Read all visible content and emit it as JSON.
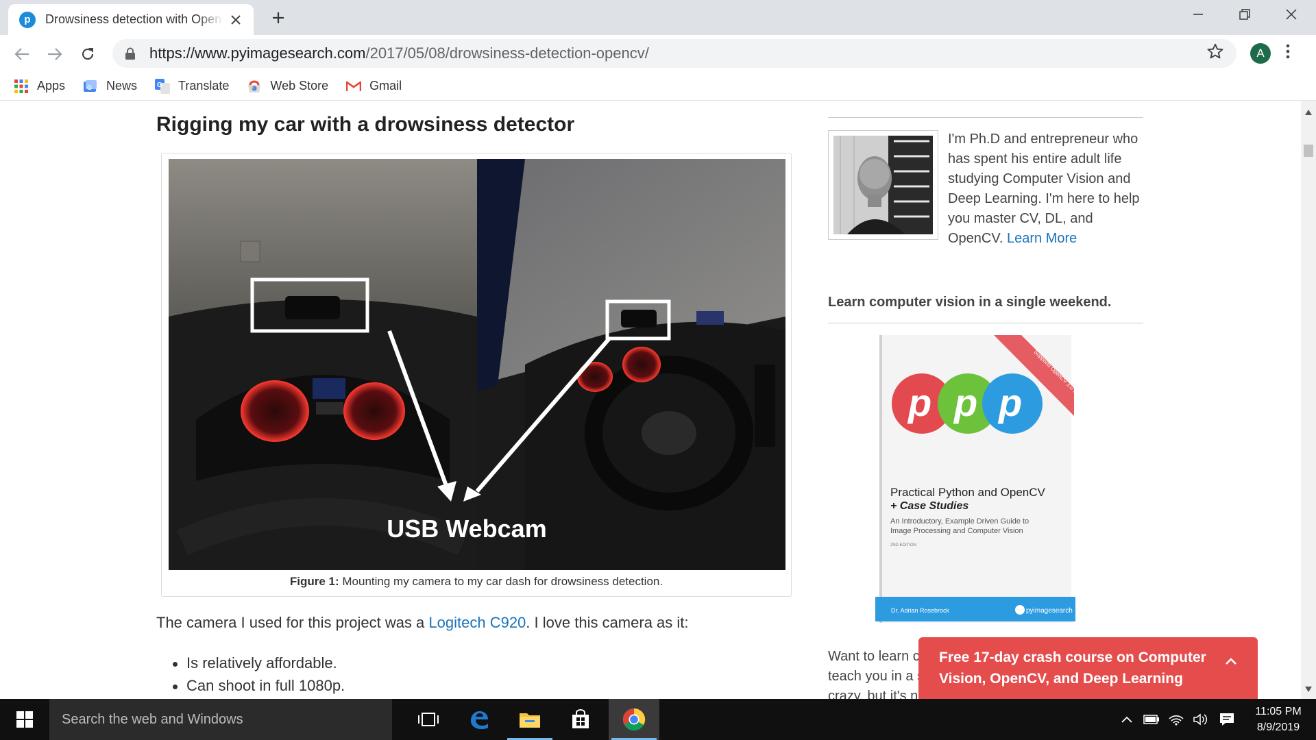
{
  "browser": {
    "tab": {
      "title": "Drowsiness detection with OpenCV",
      "favicon_text": "p"
    },
    "url_host": "https://www.pyimagesearch.com",
    "url_path": "/2017/05/08/drowsiness-detection-opencv/",
    "profile_initial": "A",
    "bookmarks": [
      {
        "label": "Apps",
        "icon": "apps-grid-icon"
      },
      {
        "label": "News",
        "icon": "news-icon"
      },
      {
        "label": "Translate",
        "icon": "translate-icon"
      },
      {
        "label": "Web Store",
        "icon": "web-store-icon"
      },
      {
        "label": "Gmail",
        "icon": "gmail-icon"
      }
    ]
  },
  "article": {
    "heading": "Rigging my car with a drowsiness detector",
    "figure_photo_text": "USB Webcam",
    "figure_caption_bold": "Figure 1:",
    "figure_caption_text": " Mounting my camera to my car dash for drowsiness detection.",
    "body_before": "The camera I used for this project was a ",
    "body_link": "Logitech C920",
    "body_after": ". I love this camera as it:",
    "features": [
      "Is relatively affordable.",
      "Can shoot in full 1080p."
    ]
  },
  "sidebar": {
    "bio": "I'm Ph.D and entrepreneur who has spent his entire adult life studying Computer Vision and Deep Learning. I'm here to help you master CV, DL, and OpenCV. ",
    "bio_link": "Learn More",
    "weekend_heading": "Learn computer vision in a single weekend.",
    "book": {
      "ribbon": "Supports OpenCV 3.0 & Python 3+!",
      "title": "Practical Python and OpenCV",
      "title2": "+ Case Studies",
      "subtitle1": "An Introductory, Example Driven Guide to",
      "subtitle2": "Image Processing and Computer Vision",
      "edition": "2ND EDITION",
      "author": "Dr. Adrian Rosebrock",
      "publisher": "pyimagesearch"
    },
    "promo_line1": "Want to learn com",
    "promo_line2": "teach you in a sing",
    "promo_line3": "crazy, but it's no joke. My new book is your"
  },
  "crash_banner": {
    "line1": "Free 17-day crash course on Computer",
    "line2": "Vision, OpenCV, and Deep Learning"
  },
  "taskbar": {
    "search_placeholder": "Search the web and Windows",
    "time": "11:05 PM",
    "date": "8/9/2019"
  }
}
